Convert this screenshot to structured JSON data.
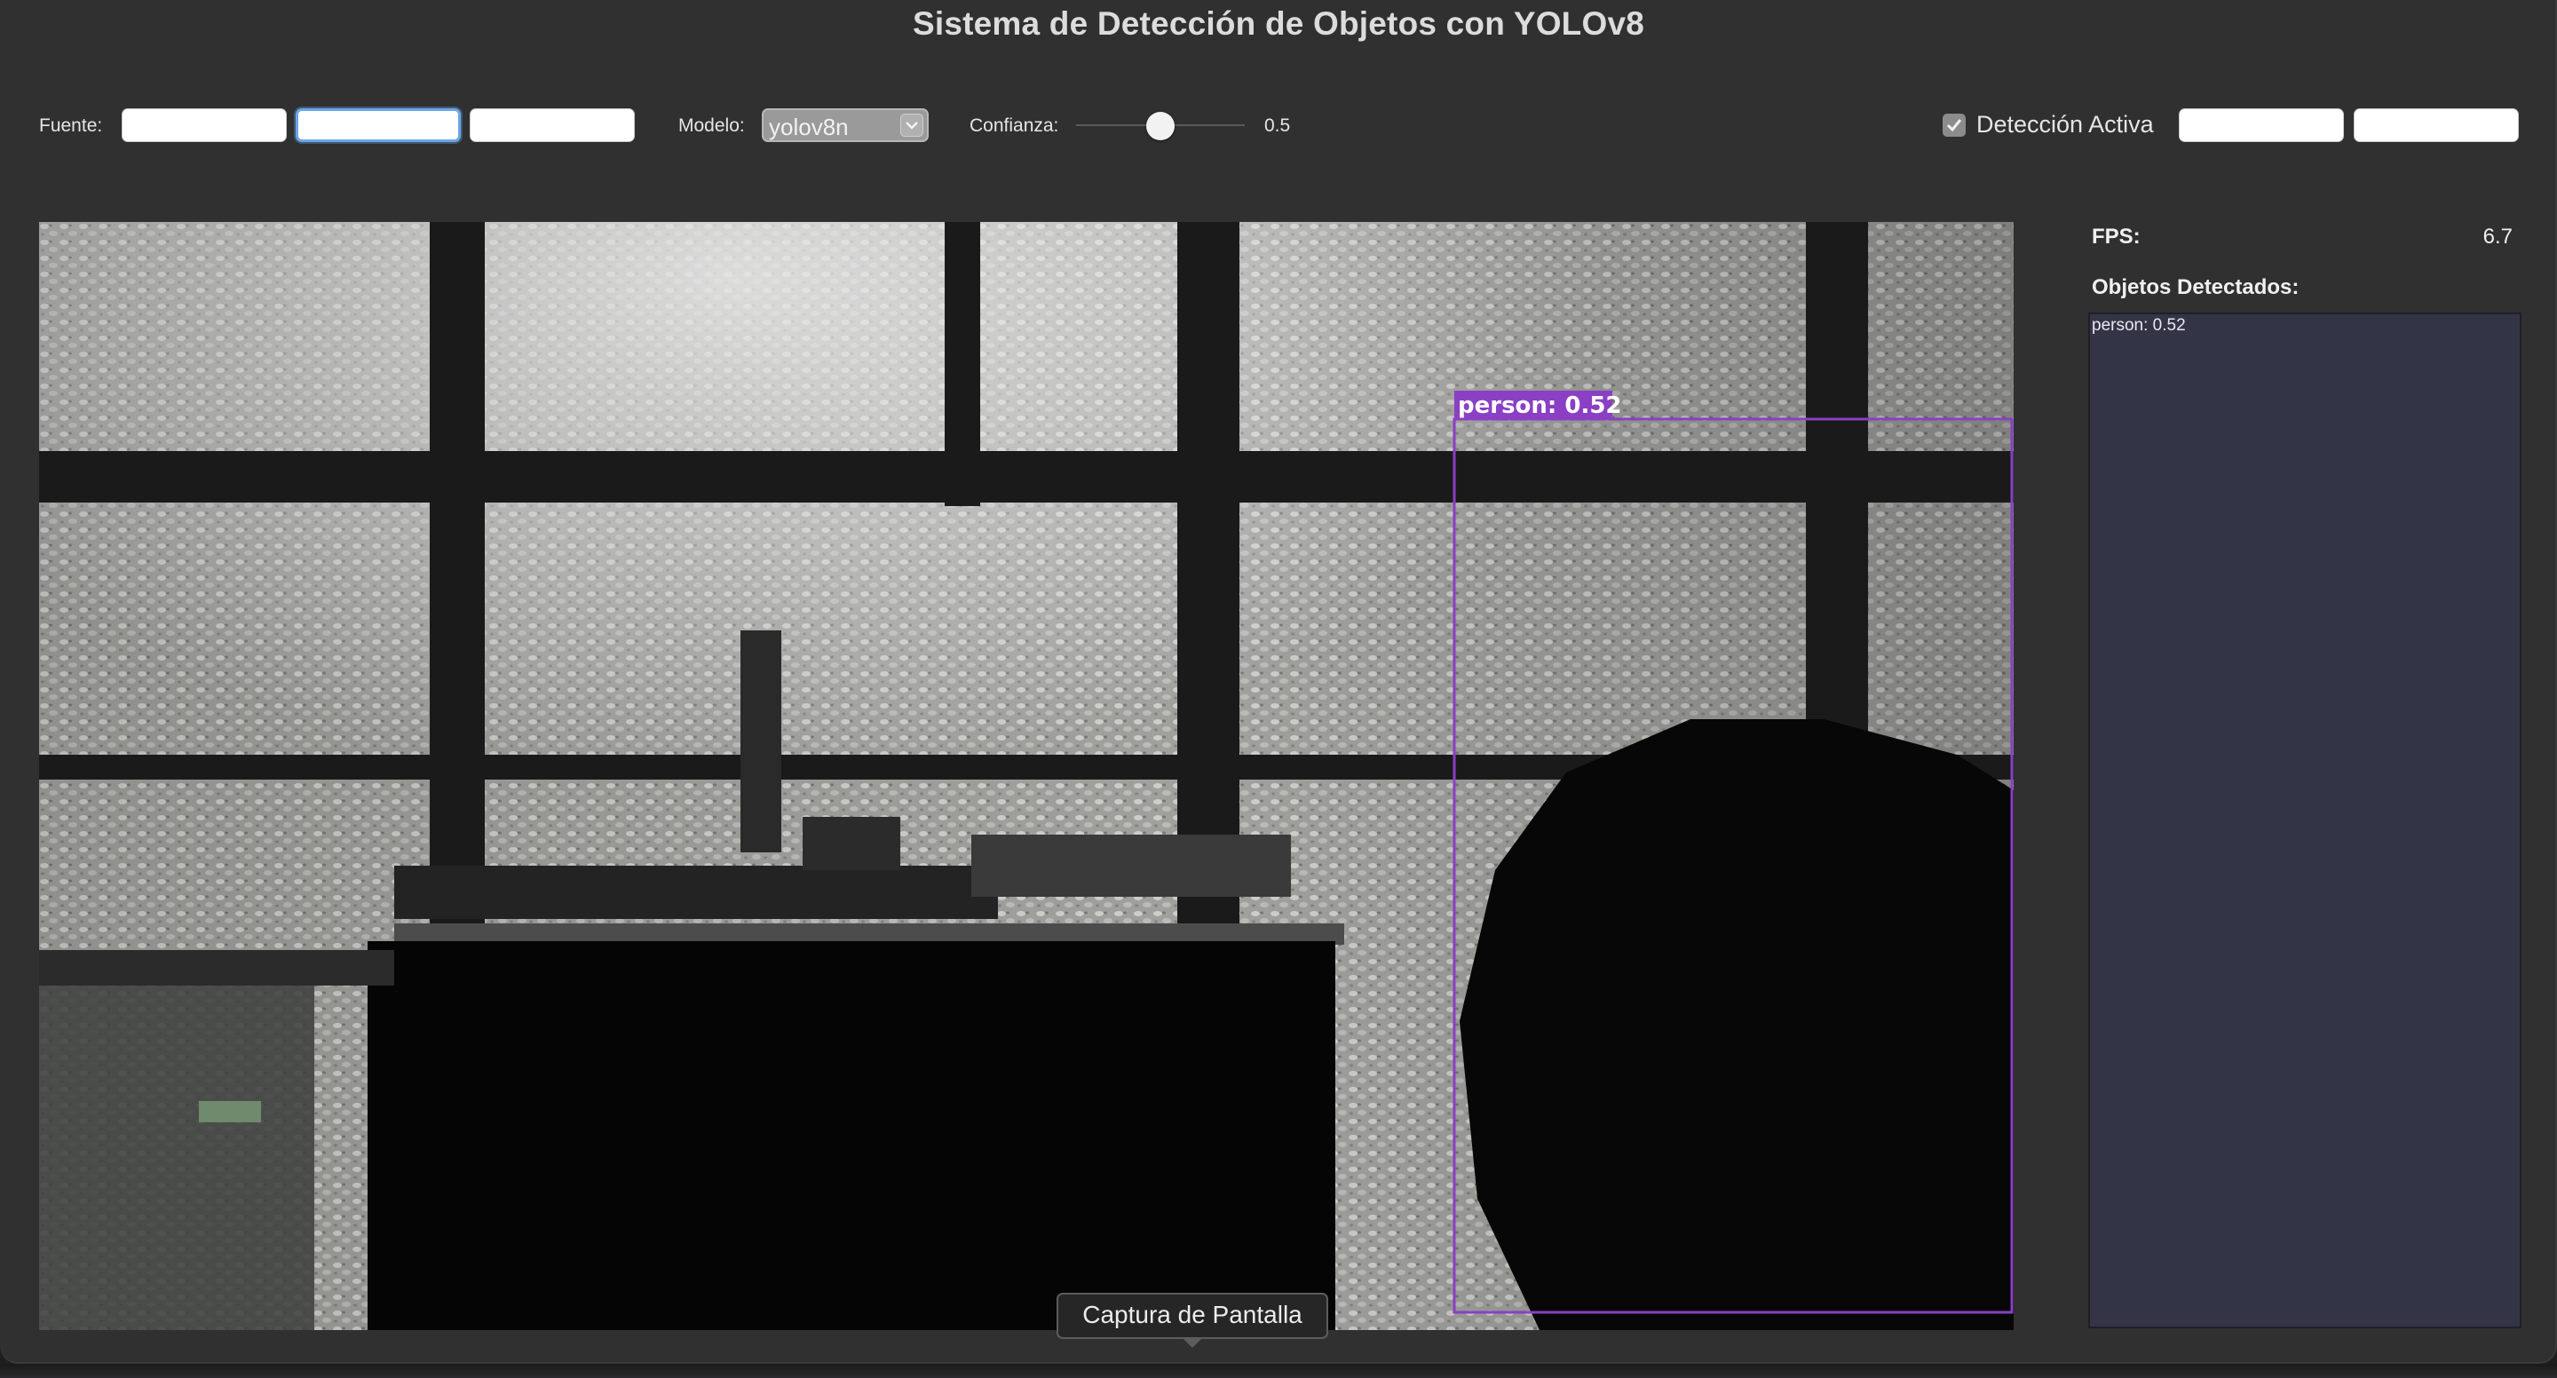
{
  "window": {
    "title": "Sistema de Detección de Objetos con YOLOv8"
  },
  "toolbar": {
    "source_label": "Fuente:",
    "source_buttons": [
      "",
      "",
      ""
    ],
    "model_label": "Modelo:",
    "model_value": "yolov8n",
    "confidence_label": "Confianza:",
    "confidence_value": "0.5",
    "confidence_fraction": 0.5,
    "detection_label": "Detección Activa",
    "detection_checked": true,
    "action_buttons": [
      "",
      ""
    ]
  },
  "video": {
    "detection": {
      "label": "person: 0.52",
      "color": "#8a3fc4"
    }
  },
  "stats": {
    "fps_label": "FPS:",
    "fps_value": "6.7",
    "objects_title": "Objetos Detectados:",
    "objects": [
      "person: 0.52"
    ]
  },
  "tooltip": {
    "text": "Captura de Pantalla"
  },
  "icons": {
    "dropdown": "chevron-down-icon",
    "checkbox": "checkmark-icon"
  }
}
